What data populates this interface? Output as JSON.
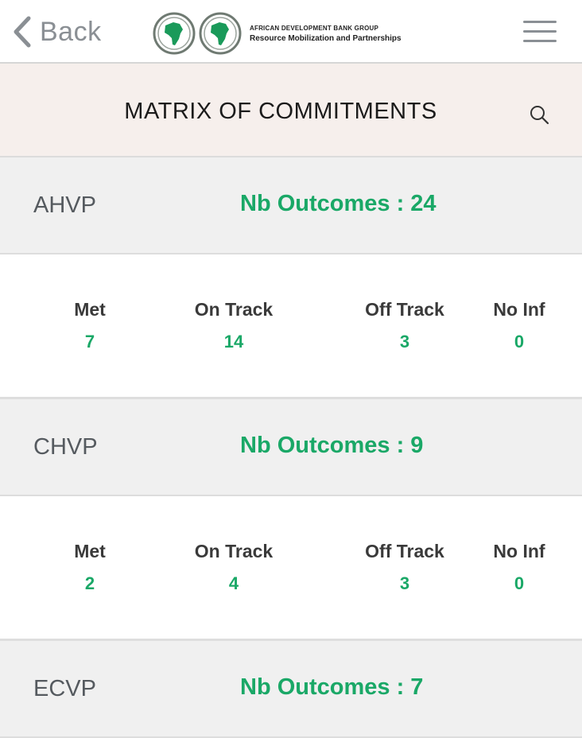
{
  "nav": {
    "back_label": "Back",
    "logo_line1": "AFRICAN DEVELOPMENT BANK GROUP",
    "logo_line2": "Resource Mobilization and Partnerships"
  },
  "page": {
    "title": "MATRIX OF COMMITMENTS"
  },
  "colors": {
    "accent_green": "#1aa867",
    "title_band": "#f6efec",
    "section_head": "#f0f0f0"
  },
  "sections": [
    {
      "name": "AHVP",
      "outcomes": "Nb Outcomes : 24",
      "stats": [
        {
          "label": "Met",
          "value": "7"
        },
        {
          "label": "On Track",
          "value": "14"
        },
        {
          "label": "Off Track",
          "value": "3"
        },
        {
          "label": "No Inf",
          "value": "0"
        }
      ]
    },
    {
      "name": "CHVP",
      "outcomes": "Nb Outcomes : 9",
      "stats": [
        {
          "label": "Met",
          "value": "2"
        },
        {
          "label": "On Track",
          "value": "4"
        },
        {
          "label": "Off Track",
          "value": "3"
        },
        {
          "label": "No Inf",
          "value": "0"
        }
      ]
    },
    {
      "name": "ECVP",
      "outcomes": "Nb Outcomes : 7"
    }
  ]
}
